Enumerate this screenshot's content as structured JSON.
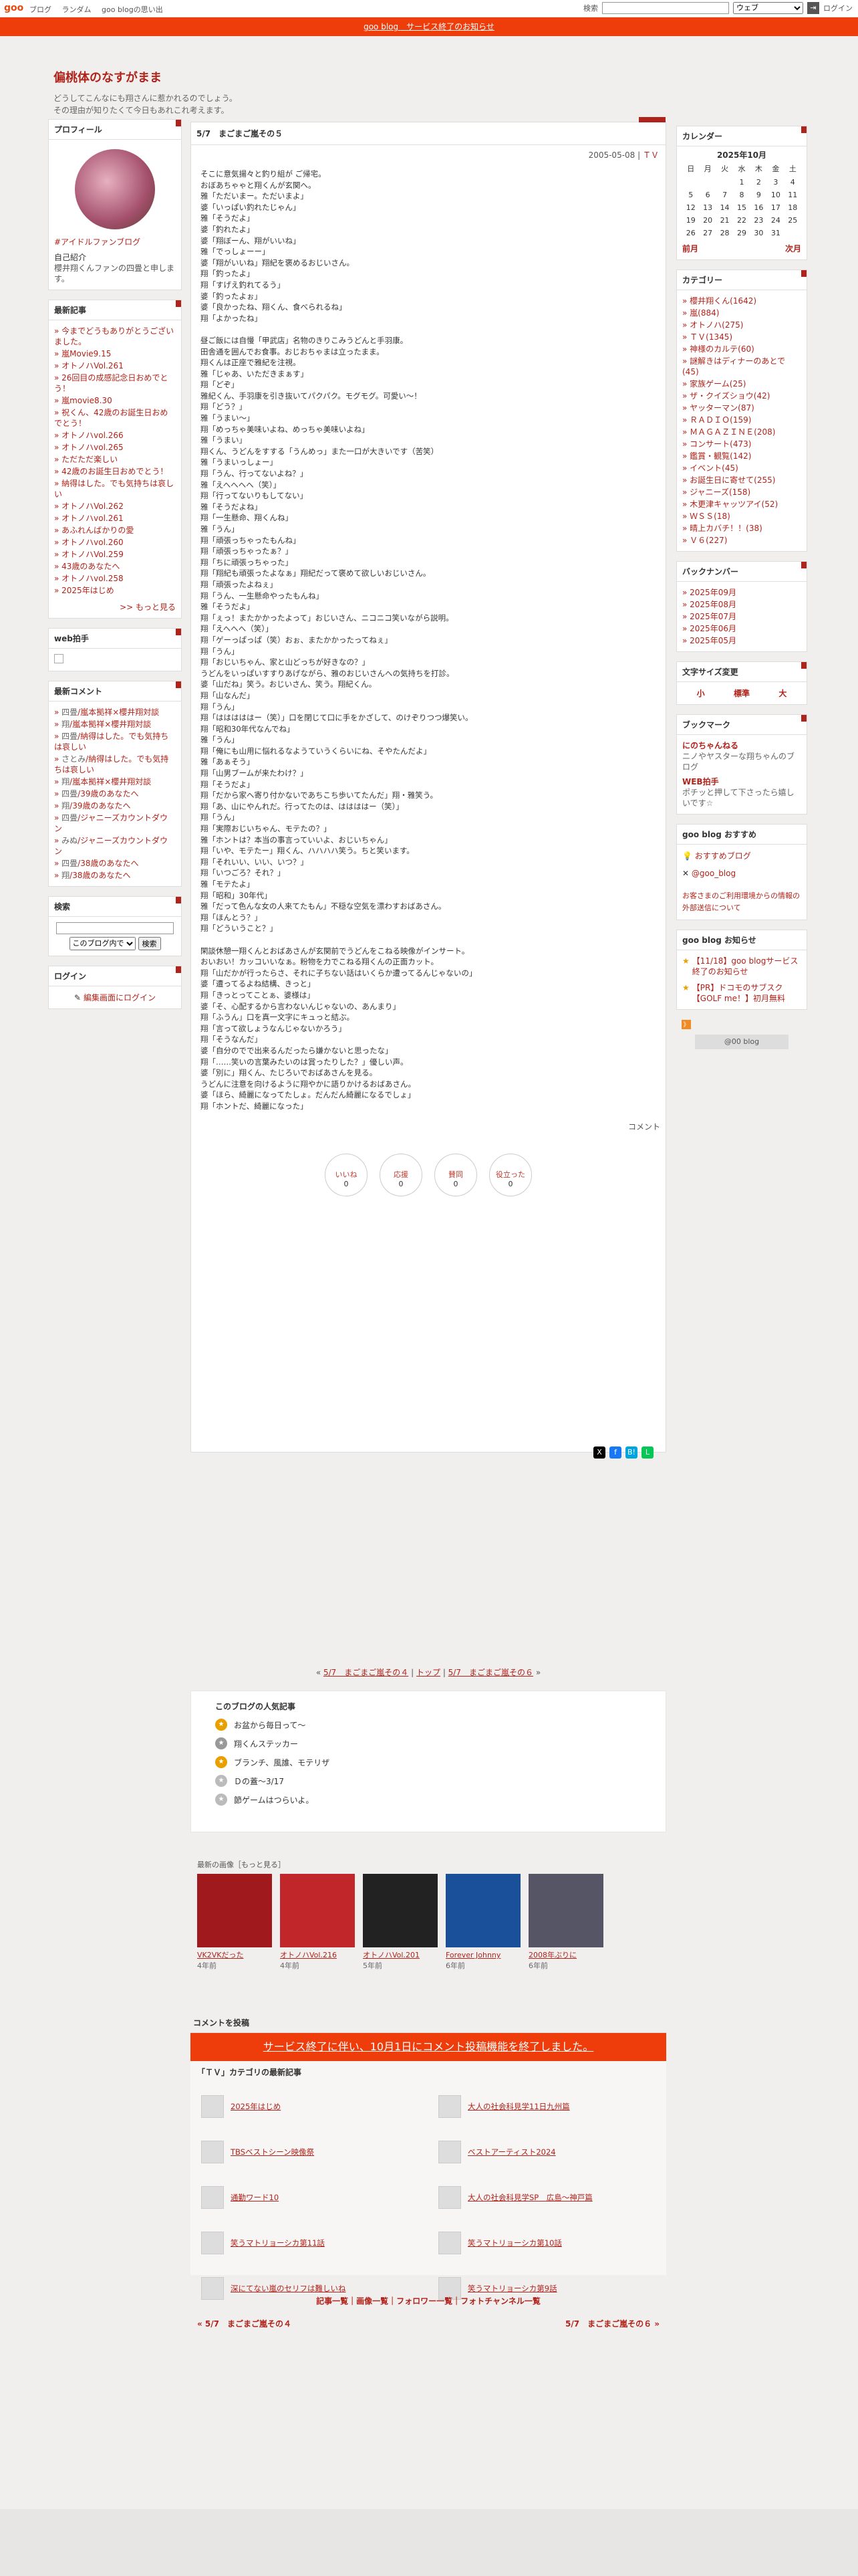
{
  "gbar": {
    "logo": "goo",
    "links": [
      "ブログ",
      "ランダム",
      "goo blogの思い出"
    ],
    "search_label": "検索",
    "search_scope": "ウェブ",
    "login": "ログイン"
  },
  "notice": "goo blog　サービス終了のお知らせ",
  "blog": {
    "title": "偏桃体のなすがまま",
    "desc1": "どうしてこんなにも翔さんに惹かれるのでしょう。",
    "desc2": "その理由が知りたくて今日もあれこれ考えます。"
  },
  "profile": {
    "title": "プロフィール",
    "name": "#アイドルファンブログ",
    "intro_label": "自己紹介",
    "intro": "櫻井翔くんファンの四畳と申します。"
  },
  "recent": {
    "title": "最新記事",
    "items": [
      "今までどうもありがとうございました。",
      "嵐Movie9.15",
      "オトノハVol.261",
      "26回目の成感記念日おめでとう！",
      "嵐movie8.30",
      "祝くん、42歳のお誕生日おめでとう！",
      "オトノハvol.266",
      "オトノハvol.265",
      "ただただ楽しい",
      "42歳のお誕生日おめでとう！",
      "納得はした。でも気持ちは哀しい",
      "オトノハVol.262",
      "オトノハvol.261",
      "あふれんばかりの愛",
      "オトノハvol.260",
      "オトノハVol.259",
      "43歳のあなたへ",
      "オトノハvol.258",
      "2025年はじめ"
    ],
    "more": ">> もっと見る"
  },
  "webclap": {
    "title": "web拍手"
  },
  "comments": {
    "title": "最新コメント",
    "items": [
      [
        "四畳",
        "嵐本拠祥×櫻井翔対談"
      ],
      [
        "翔",
        "嵐本拠祥×櫻井翔対談"
      ],
      [
        "四畳",
        "納得はした。でも気持ちは哀しい"
      ],
      [
        "さとみ",
        "納得はした。でも気持ちは哀しい"
      ],
      [
        "翔",
        "嵐本拠祥×櫻井翔対談"
      ],
      [
        "四畳",
        "39歳のあなたへ"
      ],
      [
        "翔",
        "39歳のあなたへ"
      ],
      [
        "四畳",
        "ジャニーズカウントダウン"
      ],
      [
        "みぬ",
        "ジャニーズカウントダウン"
      ],
      [
        "四畳",
        "38歳のあなたへ"
      ],
      [
        "翔",
        "38歳のあなたへ"
      ]
    ]
  },
  "search": {
    "title": "検索",
    "scope": "このブログ内で",
    "button": "検索"
  },
  "login": {
    "title": "ログイン",
    "link": "編集画面にログイン"
  },
  "article": {
    "title": "5/7　まごまご嵐その５",
    "date": "2005-05-08",
    "tv": "ＴＶ",
    "comment_label": "コメント",
    "lines": [
      "そこに意気揚々と釣り組が ご帰宅。",
      "おぼあちゃゃと翔くんが玄関へ。",
      "雅「ただいまー。ただいまよ」",
      "婆「いっぱい釣れたじゃん」",
      "雅「そうだよ」",
      "婆「釣れたよ」",
      "婆「翔ぼーん、翔がいいね」",
      "雅「でっしょーー」",
      "婆「翔がいいね」翔紀を褒めるおじいさん。",
      "翔「釣ったよ」",
      "翔「すげえ釣れてるう」",
      "婆「釣ったよぉ」",
      "婆「良かったね、翔くん、食べられるね」",
      "翔「よかったね」",
      "",
      "昼ご飯には自慢「甲武店」名物のきりこみうどんと手羽康。",
      "田舎通を囲んでお食事。おじおちゃまは立ったまま。",
      "翔くんは正座で雅紀を注視。",
      "雅「じゃあ、いただきまぁす」",
      "翔「どぞ」",
      "雅紀くん、手羽康を引き抜いてパクパク。モグモグ。可愛い〜！",
      "翔「どう？」",
      "雅「うまい〜」",
      "翔「めっちゃ美味いよね、めっちゃ美味いよね」",
      "雅「うまい」",
      "翔くん、うどんをすする「うんめっ」また一口が大きいです（苦笑）",
      "雅「うまいっしょー」",
      "翔「うん、行ってないよね？」",
      "雅「えへへへへ（笑）」",
      "翔「行ってないりもしてない」",
      "雅「そうだよね」",
      "翔「一生懸命、翔くんね」",
      "雅「うん」",
      "翔「頑張っちゃったもんね」",
      "翔「頑張っちゃったぁ？」",
      "翔「ちに頑張っちゃった」",
      "翔「翔紀も頑張ったよなぁ」翔紀だって褒めて欲しいおじいさん。",
      "翔「頑張ったよねぇ」",
      "翔「うん、一生懸命やったもんね」",
      "雅「そうだよ」",
      "翔「ぇっ！またかかったよって」おじいさん、ニコニコ笑いながら説明。",
      "翔「えへへへ（笑）」",
      "翔「ゲーっぱっぱ（笑）おぉ、またかかったってねぇ」",
      "翔「うん」",
      "翔「おじいちゃん、家と山どっちが好きなの？」",
      "うどんをいっぱいすすりあげながら、雅のおじいさんへの気持ちを打診。",
      "婆「山だね」笑う。おじいさん、笑う。翔紀くん。",
      "翔「山なんだ」",
      "翔「うん」",
      "翔「はははははー（笑）」口を閉じて口に手をかざして、のけぞりつつ爆笑い。",
      "翔「昭和30年代なんでね」",
      "雅「うん」",
      "翔「俺にも山用に悩れるなようていうくらいにね、そやたんだよ」",
      "雅「あぁそう」",
      "翔「山男ブームが来たわけ？」",
      "翔「そうだよ」",
      "翔「だから家へ寄り付かないであちこち歩いてたんだ」翔・雅笑う。",
      "翔「あ、山にやんれだ。行ってたのは、ははははー（笑）」",
      "翔「うん」",
      "翔「実際おじいちゃん、モテたの？」",
      "雅「ホントは？本当の事言っていいよ、おじいちゃん」",
      "翔「いや、モテたー」翔くん、ハハハハ笑う。ちと笑います。",
      "翔「それいい、いい、いつ？」",
      "翔「いつごろ？それ？」",
      "雅「モテたよ」",
      "翔「昭和」30年代」",
      "雅「だって色んな女の人来てたもん」不穏な空気を漂わすおばあさん。",
      "翔「ほんとう？」",
      "翔「どういうこと？」",
      "",
      "閑談休憩一翔くんとおばあさんが玄関前でうどんをこねる映像がインサート。",
      "おいおい！カッコいいなぁ。粉物を力でこねる翔くんの正面カット。",
      "翔「山だかが行ったらさ、それに子ちない話はいくらか遭ってるんじゃないの」",
      "婆「遭ってるよね結構、きっと」",
      "翔「きっとってことぁ、婆様は」",
      "婆「そ、心配するから言わないんじゃないの、あんまり」",
      "翔「ふうん」口を真一文字にキュっと結ぶ。",
      "翔「言って欲しょうなんじゃないかろう」",
      "翔「そうなんだ」",
      "婆「自分のでで出来るんだったら嫌かないと思ったな」",
      "翔「……笑いの言葉みたいのは賞ったりした？」優しい声。",
      "婆「別に」翔くん、たじろいでおばあさんを見る。",
      "うどんに注意を向けるように翔やかに語りかけるおばあさん。",
      "婆「ほら、綺麗になってたしょ。だんだん綺麗になるでしょ」",
      "翔「ホントだ、綺麗になった」"
    ],
    "reactions": [
      [
        "いいね",
        "0"
      ],
      [
        "応援",
        "0"
      ],
      [
        "賛同",
        "0"
      ],
      [
        "役立った",
        "0"
      ]
    ]
  },
  "nav": {
    "prev": "5/7　まごまご嵐その４",
    "top": "トップ",
    "next": "5/7　まごまご嵐その６"
  },
  "popular": {
    "title": "このブログの人気記事",
    "items": [
      "お盆から毎日って〜",
      "翔くんステッカー",
      "ブランチ、風誰、モテリザ",
      "Ｄの蓋〜3/17",
      "節ゲームはつらいよ。"
    ]
  },
  "recentimgs": {
    "title": "最新の画像［もっと見る］",
    "items": [
      [
        "VK2VKだった",
        "4年前"
      ],
      [
        "オトノハVol.216",
        "4年前"
      ],
      [
        "オトノハVol.201",
        "5年前"
      ],
      [
        "Forever Johnny",
        "6年前"
      ],
      [
        "2008年ぶりに",
        "6年前"
      ]
    ]
  },
  "comment_section": {
    "title": "コメントを投稿",
    "notice": "サービス終了に伴い、10月1日にコメント投稿機能を終了しました。"
  },
  "cat_articles": {
    "title": "「ＴＶ」カテゴリの最新記事",
    "items": [
      "2025年はじめ",
      "大人の社会科見学11日九州篇",
      "TBSベストシーン映像祭",
      "ベストアーティスト2024",
      "通勤ワード10",
      "大人の社会科見学SP　広島〜神戸篇",
      "笑うマトリョーシカ第11話",
      "笑うマトリョーシカ第10話",
      "深にてない嵐のセリフは難しいね",
      "笑うマトリョーシカ第9話"
    ]
  },
  "footlinks": "記事一覧｜画像一覧｜フォロワー一覧｜フォトチャンネル一覧",
  "bottomnav": {
    "prev": "« 5/7　まごまご嵐その４",
    "next": "5/7　まごまご嵐その６ »"
  },
  "calendar": {
    "title": "カレンダー",
    "month": "2025年10月",
    "dow": [
      "日",
      "月",
      "火",
      "水",
      "木",
      "金",
      "土"
    ],
    "days": [
      "",
      "",
      "",
      "1",
      "2",
      "3",
      "4",
      "5",
      "6",
      "7",
      "8",
      "9",
      "10",
      "11",
      "12",
      "13",
      "14",
      "15",
      "16",
      "17",
      "18",
      "19",
      "20",
      "21",
      "22",
      "23",
      "24",
      "25",
      "26",
      "27",
      "28",
      "29",
      "30",
      "31",
      ""
    ],
    "prev": "前月",
    "next": "次月"
  },
  "category": {
    "title": "カテゴリー",
    "items": [
      "櫻井翔くん(1642)",
      "嵐(884)",
      "オトノハ(275)",
      "ＴＶ(1345)",
      "神様のカルテ(60)",
      "謎解きはディナーのあとで(45)",
      "家族ゲーム(25)",
      "ザ・クイズショウ(42)",
      "ヤッターマン(87)",
      "ＲＡＤＩＯ(159)",
      "ＭＡＧＡＺＩＮＥ(208)",
      "コンサート(473)",
      "鑑賞・観覧(142)",
      "イベント(45)",
      "お誕生日に寄せて(255)",
      "ジャニーズ(158)",
      "木更津キャッツアイ(52)",
      "ＷＳＳ(18)",
      "晴上カバチ！！(38)",
      "Ｖ６(227)"
    ]
  },
  "backnumber": {
    "title": "バックナンバー",
    "items": [
      "2025年09月",
      "2025年08月",
      "2025年07月",
      "2025年06月",
      "2025年05月"
    ]
  },
  "fontsize": {
    "title": "文字サイズ変更",
    "items": [
      "小",
      "標準",
      "大"
    ]
  },
  "bookmark": {
    "title": "ブックマーク",
    "items": [
      [
        "にのちゃんねる",
        "ニノやヤスターな翔ちゃんのブログ"
      ],
      [
        "WEB拍手",
        "ポチッと押して下さったら嬉しいです☆"
      ]
    ]
  },
  "goorec": {
    "title": "goo blog おすすめ",
    "item1": "おすすめブログ",
    "item2": "@goo_blog",
    "info": "お客さまのご利用環境からの情報の外部送信について"
  },
  "goonotice": {
    "title": "goo blog お知らせ",
    "items": [
      "【11/18】goo blogサービス終了のお知らせ",
      "【PR】ドコモのサブスク【GOLF me！】初月無料"
    ],
    "badge": "@00 blog"
  }
}
